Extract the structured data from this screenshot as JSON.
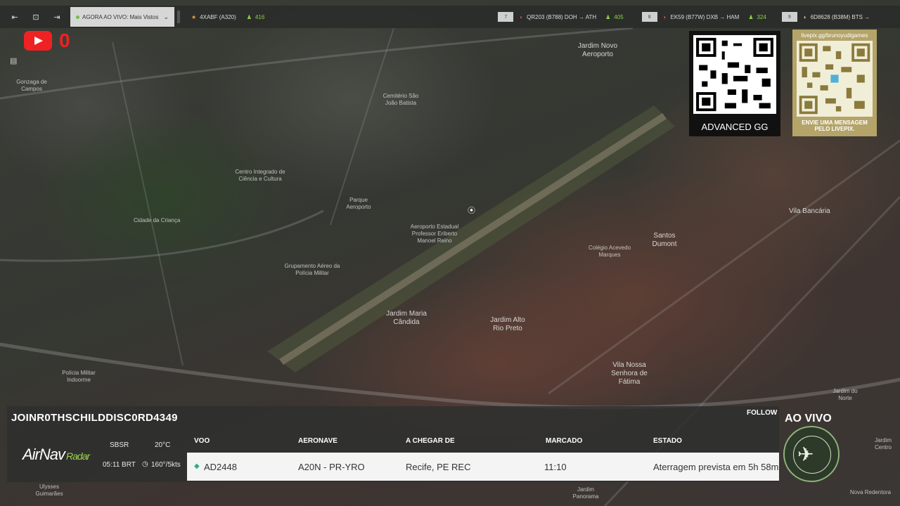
{
  "topbar": {
    "now_live": "AGORA AO VIVO: Mais Vistos",
    "flights": [
      {
        "badge": "",
        "text": "4XABF (A320)",
        "count": "416"
      },
      {
        "badge": "7",
        "text": "QR203 (B788)  DOH → ATH",
        "count": "405"
      },
      {
        "badge": "8",
        "text": "EK59 (B77W)  DXB → HAM",
        "count": "324"
      },
      {
        "badge": "9",
        "text": "6D8628 (B38M)  BTS →",
        "count": ""
      }
    ]
  },
  "youtube": {
    "count": "0"
  },
  "qr_codes": {
    "left_caption": "ADVANCED GG",
    "right_url": "livepix.gg/brunoyudigames",
    "right_caption": "ENVIE UMA MENSAGEM PELO LIVEPIX."
  },
  "map_labels": {
    "gonzaga": "Gonzaga de Campos",
    "jardim_novo": "Jardim Novo Aeroporto",
    "cemiterio": "Cemitério São João Batista",
    "centro": "Centro Integrado de Ciência e Cultura",
    "cidade_crianca": "Cidade da Criança",
    "aeroporto": "Aeroporto Estadual Professor Eriberto Manoel Reino",
    "grupamento": "Grupamento Aéreo da Polícia Militar",
    "jardim_maria": "Jardim Maria Cândida",
    "jardim_alto": "Jardim Alto Rio Preto",
    "santos_dumont": "Santos Dumont",
    "colegio": "Colégio Acevedo Marques",
    "vila_nossa": "Vila Nossa Senhora de Fátima",
    "jardim_norte": "Jardim do Norte",
    "vila_bancaria": "Vila Bancária",
    "jardim_panorama": "Jardim Panorama",
    "nova_redentora": "Nova Redentora",
    "ulysses": "Ulysses Guimarães",
    "policia": "Polícia Militar Indoorme",
    "parque": "Parque Aeroporto",
    "jardim_centro": "Jardim Centro"
  },
  "panel": {
    "channel": "JOINR0THSCHILDDISC0RD4349",
    "follow": "FOLLOW",
    "logo_main": "AirNav",
    "logo_sub": "Radar",
    "weather": {
      "station": "SBSR",
      "temp": "20°C",
      "time": "05:11 BRT",
      "wind": "160°/5kts"
    },
    "headers": {
      "flight": "VOO",
      "aircraft": "AERONAVE",
      "from": "A CHEGAR DE",
      "scheduled": "MARCADO",
      "status": "ESTADO"
    },
    "row": {
      "flight": "AD2448",
      "aircraft": "A20N - PR-YRO",
      "from": "Recife, PE REC",
      "scheduled": "11:10",
      "status": "Aterragem prevista em 5h 58m"
    }
  },
  "badge": {
    "title": "AO VIVO"
  },
  "colors": {
    "accent_green": "#8bd24a",
    "youtube_red": "#e22222",
    "livepix_gold": "#b4a46a"
  }
}
